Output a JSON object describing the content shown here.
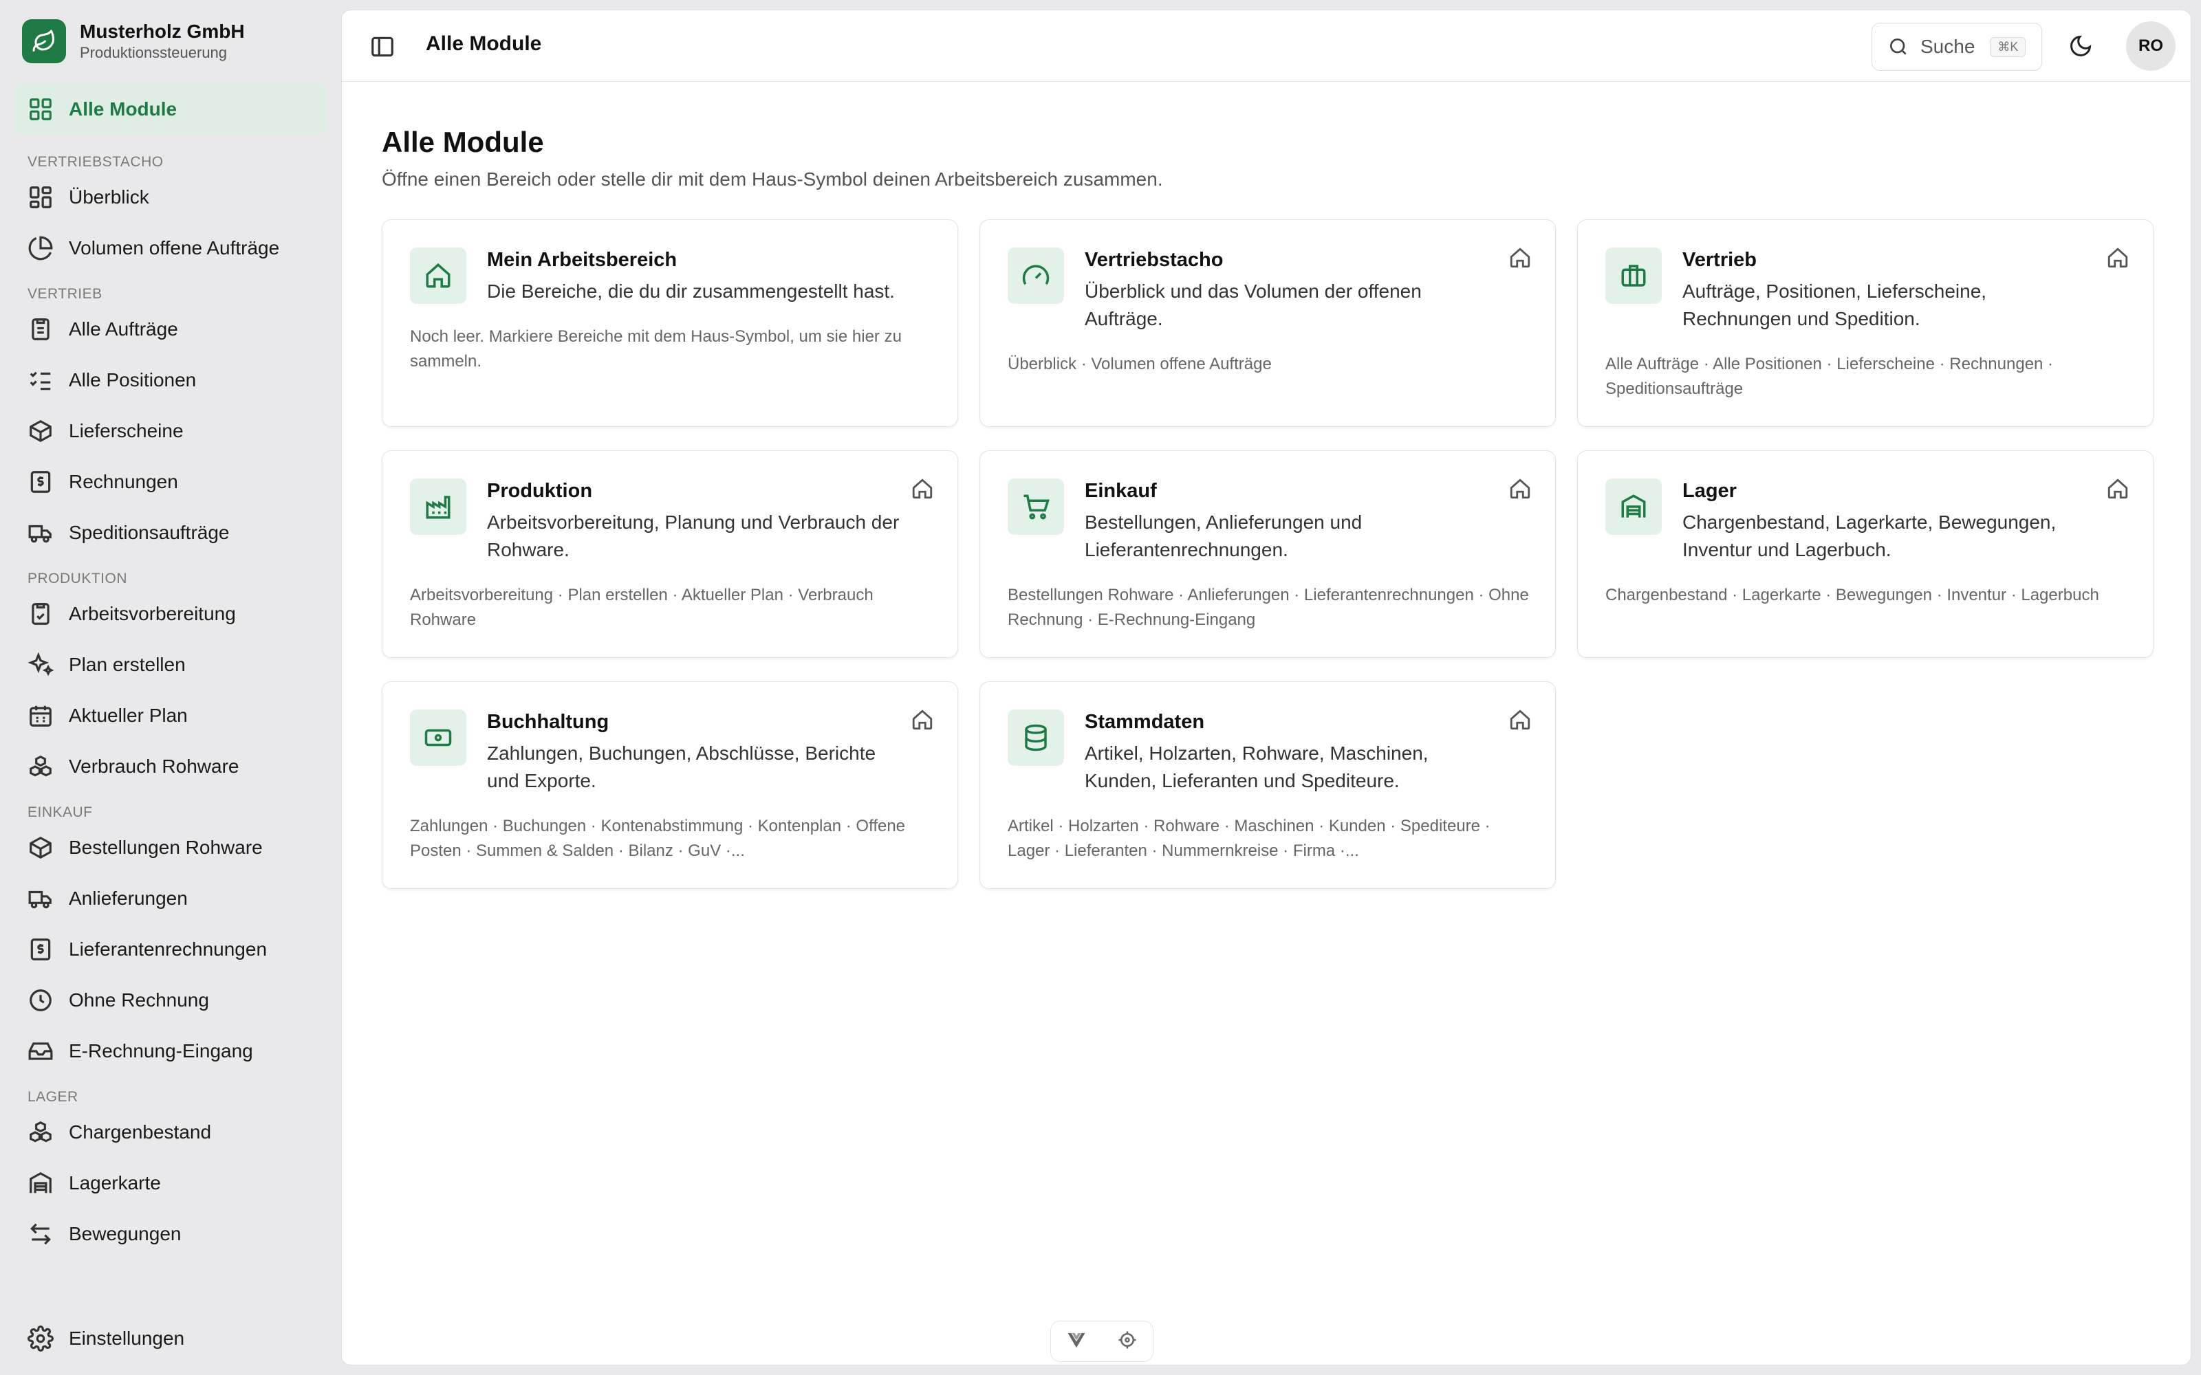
{
  "brand": {
    "name": "Musterholz GmbH",
    "subtitle": "Produktionssteuerung"
  },
  "nav": {
    "top": {
      "label": "Alle Module",
      "icon": "grid-icon"
    },
    "sections": [
      {
        "title": "VERTRIEBSTACHO",
        "items": [
          {
            "label": "Überblick",
            "icon": "layout-icon"
          },
          {
            "label": "Volumen offene Aufträge",
            "icon": "pie-chart-icon"
          }
        ]
      },
      {
        "title": "VERTRIEB",
        "items": [
          {
            "label": "Alle Aufträge",
            "icon": "clipboard-list-icon"
          },
          {
            "label": "Alle Positionen",
            "icon": "list-checks-icon"
          },
          {
            "label": "Lieferscheine",
            "icon": "package-icon"
          },
          {
            "label": "Rechnungen",
            "icon": "receipt-dollar-icon"
          },
          {
            "label": "Speditionsaufträge",
            "icon": "truck-icon"
          }
        ]
      },
      {
        "title": "PRODUKTION",
        "items": [
          {
            "label": "Arbeitsvorbereitung",
            "icon": "clipboard-check-icon"
          },
          {
            "label": "Plan erstellen",
            "icon": "sparkles-icon"
          },
          {
            "label": "Aktueller Plan",
            "icon": "calendar-icon"
          },
          {
            "label": "Verbrauch Rohware",
            "icon": "boxes-icon"
          }
        ]
      },
      {
        "title": "EINKAUF",
        "items": [
          {
            "label": "Bestellungen Rohware",
            "icon": "package-icon"
          },
          {
            "label": "Anlieferungen",
            "icon": "truck-icon"
          },
          {
            "label": "Lieferantenrechnungen",
            "icon": "receipt-dollar-icon"
          },
          {
            "label": "Ohne Rechnung",
            "icon": "clock-icon"
          },
          {
            "label": "E-Rechnung-Eingang",
            "icon": "inbox-icon"
          }
        ]
      },
      {
        "title": "LAGER",
        "items": [
          {
            "label": "Chargenbestand",
            "icon": "boxes-icon"
          },
          {
            "label": "Lagerkarte",
            "icon": "warehouse-icon"
          },
          {
            "label": "Bewegungen",
            "icon": "arrows-icon"
          }
        ]
      }
    ],
    "settings": {
      "label": "Einstellungen",
      "icon": "gear-icon"
    }
  },
  "topbar": {
    "title": "Alle Module",
    "search_label": "Suche",
    "search_shortcut": "⌘K",
    "avatar": "RO"
  },
  "page": {
    "title": "Alle Module",
    "subtitle": "Öffne einen Bereich oder stelle dir mit dem Haus-Symbol deinen Arbeitsbereich zusammen."
  },
  "cards": [
    {
      "title": "Mein Arbeitsbereich",
      "desc": "Die Bereiche, die du dir zusammengestellt hast.",
      "links": "Noch leer. Markiere Bereiche mit dem Haus-Symbol, um sie hier zu sammeln.",
      "icon": "home-icon",
      "pin": false
    },
    {
      "title": "Vertriebstacho",
      "desc": "Überblick und das Volumen der offenen Aufträge.",
      "links": "Überblick · Volumen offene Aufträge",
      "icon": "gauge-icon",
      "pin": true
    },
    {
      "title": "Vertrieb",
      "desc": "Aufträge, Positionen, Lieferscheine, Rechnungen und Spedition.",
      "links": "Alle Aufträge · Alle Positionen · Lieferscheine · Rechnungen · Speditionsaufträge",
      "icon": "briefcase-icon",
      "pin": true
    },
    {
      "title": "Produktion",
      "desc": "Arbeitsvorbereitung, Planung und Verbrauch der Rohware.",
      "links": "Arbeitsvorbereitung · Plan erstellen · Aktueller Plan · Verbrauch Rohware",
      "icon": "factory-icon",
      "pin": true
    },
    {
      "title": "Einkauf",
      "desc": "Bestellungen, Anlieferungen und Lieferantenrechnungen.",
      "links": "Bestellungen Rohware · Anlieferungen · Lieferantenrechnungen · Ohne Rechnung · E-Rechnung-Eingang",
      "icon": "cart-icon",
      "pin": true
    },
    {
      "title": "Lager",
      "desc": "Chargenbestand, Lagerkarte, Bewegungen, Inventur und Lagerbuch.",
      "links": "Chargenbestand · Lagerkarte · Bewegungen · Inventur · Lagerbuch",
      "icon": "warehouse-icon",
      "pin": true
    },
    {
      "title": "Buchhaltung",
      "desc": "Zahlungen, Buchungen, Abschlüsse, Berichte und Exporte.",
      "links": "Zahlungen · Buchungen · Kontenabstimmung · Kontenplan · Offene Posten · Summen & Salden · Bilanz · GuV ·...",
      "icon": "banknote-icon",
      "pin": true
    },
    {
      "title": "Stammdaten",
      "desc": "Artikel, Holzarten, Rohware, Maschinen, Kunden, Lieferanten und Spediteure.",
      "links": "Artikel · Holzarten · Rohware · Maschinen · Kunden · Spediteure · Lager · Lieferanten · Nummernkreise · Firma ·...",
      "icon": "database-icon",
      "pin": true
    }
  ],
  "colors": {
    "accent": "#1f7a45",
    "accent_bg": "#dfeee4",
    "icon_bg": "#e3f2e8"
  }
}
